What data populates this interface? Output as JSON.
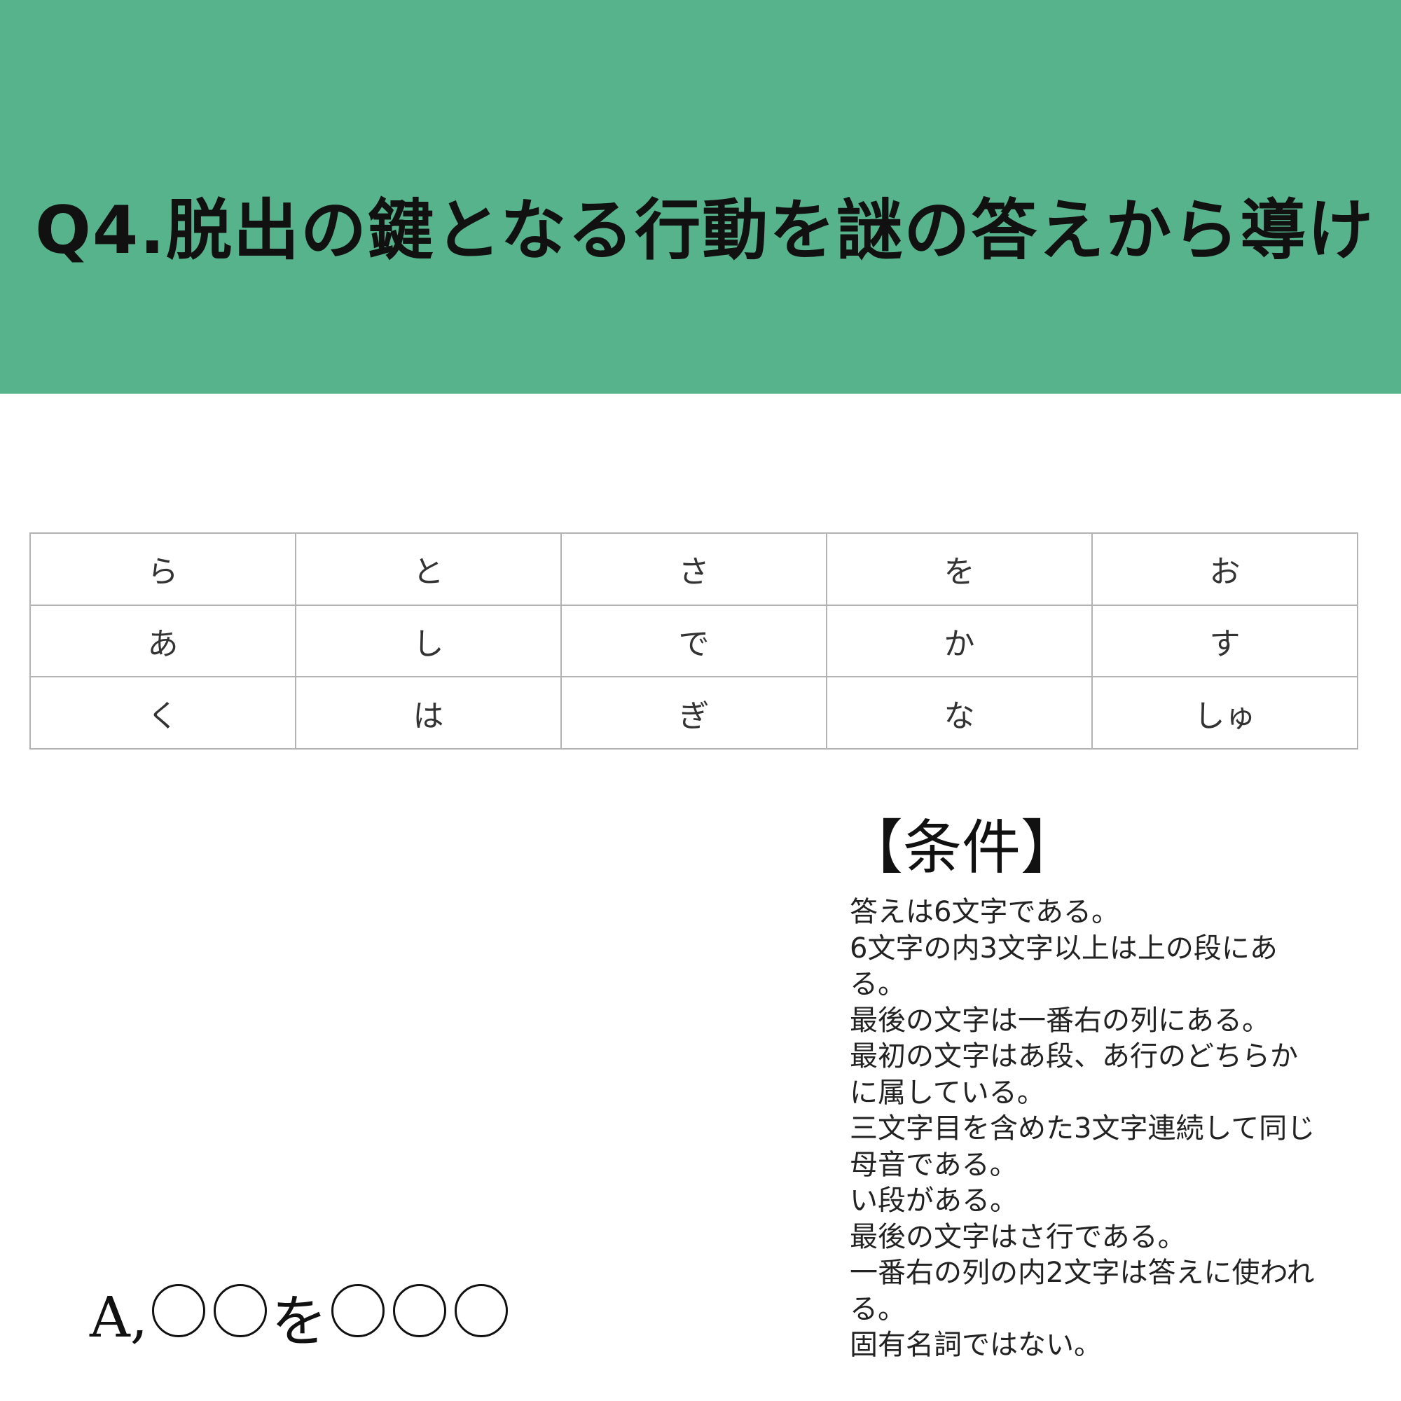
{
  "header": {
    "title": "Q4.脱出の鍵となる行動を謎の答えから導け",
    "background_color": "#56b38c"
  },
  "grid": {
    "rows": [
      [
        "ら",
        "と",
        "さ",
        "を",
        "お"
      ],
      [
        "あ",
        "し",
        "で",
        "か",
        "す"
      ],
      [
        "く",
        "は",
        "ぎ",
        "な",
        "しゅ"
      ]
    ]
  },
  "conditions": {
    "heading": "【条件】",
    "lines": [
      "答えは6文字である。",
      "6文字の内3文字以上は上の段にあ",
      "る。",
      "最後の文字は一番右の列にある。",
      "最初の文字はあ段、あ行のどちらか",
      "に属している。",
      "三文字目を含めた3文字連続して同じ",
      "母音である。",
      "い段がある。",
      "最後の文字はさ行である。",
      "一番右の列の内2文字は答えに使われ",
      "る。",
      "固有名詞ではない。"
    ]
  },
  "answer": {
    "prefix": "A,",
    "particle": "を",
    "blank_count_first": 2,
    "blank_count_second": 3
  }
}
